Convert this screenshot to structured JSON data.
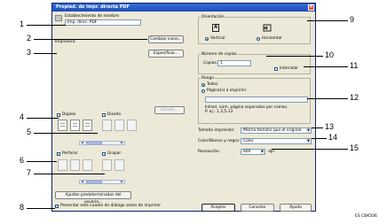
{
  "window": {
    "title": "Propied. de impr. directa PDF"
  },
  "preset": {
    "label": "Establecimiento de nombre:",
    "value": "Imp. direc. PDF"
  },
  "buttons": {
    "change_name": "Cambiar icono...",
    "specify": "Especificar...",
    "details": "Detalle...",
    "user_defaults": "Ajustes predeterminados del usuario...",
    "ok": "Aceptar",
    "cancel": "Cancelar",
    "help": "Ayuda"
  },
  "printer": {
    "label": "Impresora:"
  },
  "orientation": {
    "group_label": "Orientación",
    "portrait_label": "Vertical",
    "landscape_label": "Horizontal",
    "portrait_icon_glyph": "🄰",
    "selected": "portrait"
  },
  "copies": {
    "group_label": "Número de copias",
    "copies_label": "Copias:",
    "value": "1",
    "collate_label": "Intercalar"
  },
  "range": {
    "group_label": "Rango",
    "all_label": "Todos",
    "pages_label": "Página(s) a imprimir",
    "hint_line1": "Introd. núm. página separados por comas.",
    "hint_line2": "P. ej.: 1,3,5-13"
  },
  "paper_size": {
    "label": "Tamaño impresión:",
    "value": "Mismo tamaño que el original"
  },
  "color_mode": {
    "label": "Color/Blanco y negro:",
    "value": "Color"
  },
  "resolution": {
    "label": "Resolución:",
    "value": "600",
    "unit": "dpi"
  },
  "duplex": {
    "label": "Dúplex",
    "style_label": "Diseño"
  },
  "punch": {
    "label": "Perforar",
    "staple_label": "Grapar"
  },
  "show_dialog_label": "Presentar este cuadro de diálogo antes de imprimir",
  "callouts": [
    "1",
    "2",
    "3",
    "4",
    "5",
    "6",
    "7",
    "8",
    "9",
    "10",
    "11",
    "12",
    "13",
    "14",
    "15"
  ],
  "image_code": "ES CBK506"
}
